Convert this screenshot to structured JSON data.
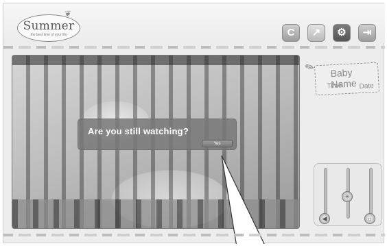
{
  "app": {
    "logo": {
      "name": "Summer",
      "tagline": "the best time of your life"
    },
    "toolbar": {
      "buttons": [
        {
          "icon": "refresh-icon",
          "glyph": "C"
        },
        {
          "icon": "fullscreen-icon",
          "glyph": "↗"
        },
        {
          "icon": "settings-icon",
          "glyph": "⚙"
        },
        {
          "icon": "exit-icon",
          "glyph": "⇥"
        }
      ]
    }
  },
  "dialog": {
    "title": "Are you still watching?",
    "yes_label": "Yes"
  },
  "baby_tag": {
    "name": "Baby Name",
    "time_label": "Time",
    "date_label": "Date"
  },
  "controls": {
    "sliders": [
      {
        "name": "volume",
        "icon": "speaker-icon",
        "level": 0.0
      },
      {
        "name": "zoom",
        "icon": "zoom-icon",
        "level": 0.5
      },
      {
        "name": "brightness",
        "icon": "brightness-icon",
        "level": 0.0
      }
    ]
  },
  "colors": {
    "frame": "#ededed",
    "dialog": "#787878",
    "accent": "#8a8a8a"
  }
}
